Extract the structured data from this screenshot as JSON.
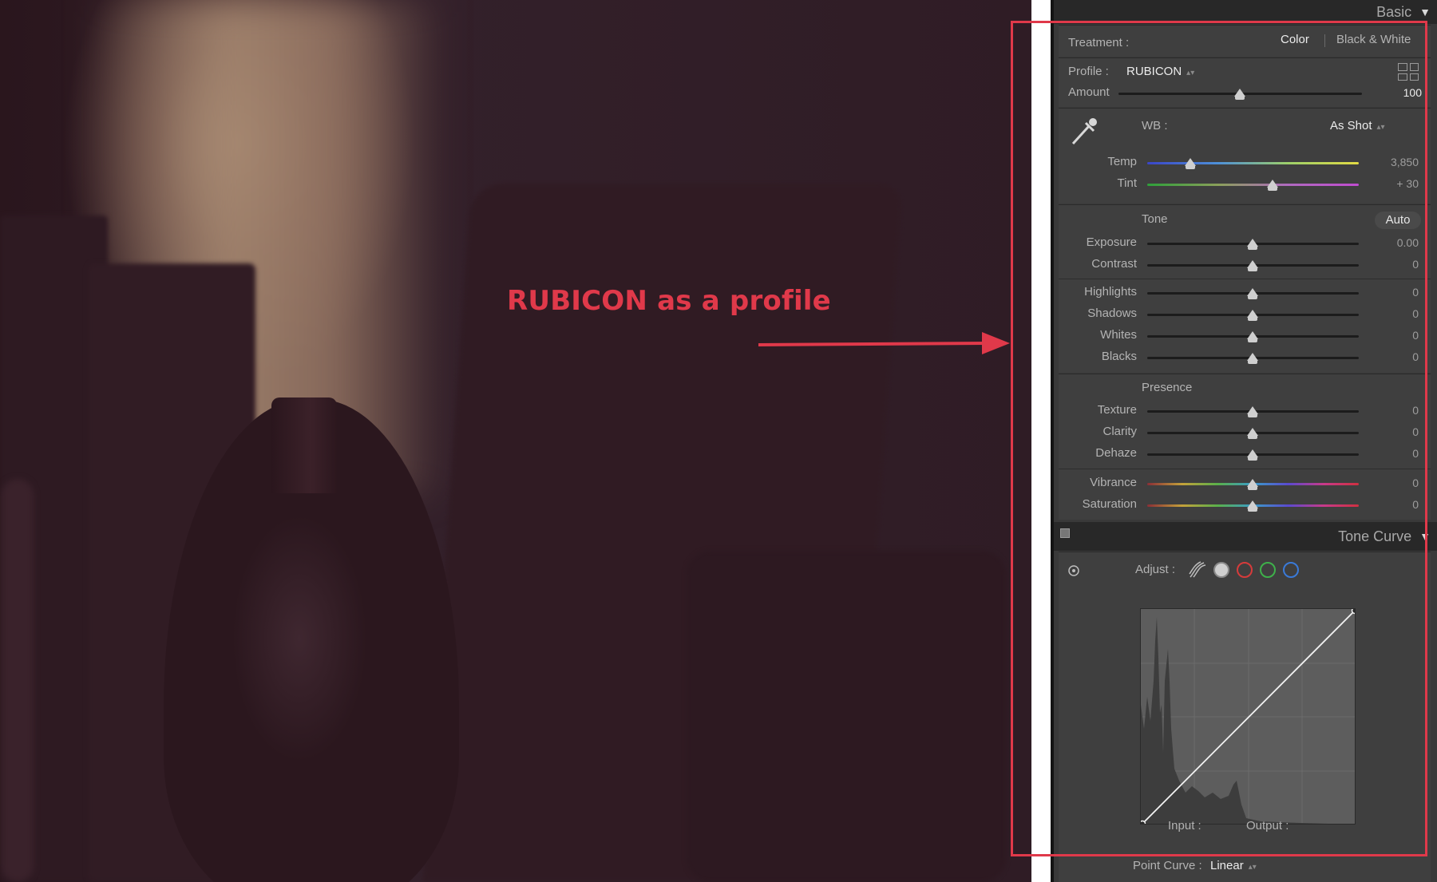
{
  "annotation": {
    "text": "RUBICON as a profile",
    "color": "#e0394a"
  },
  "panel": {
    "basic_header": "Basic",
    "treatment": {
      "label": "Treatment :",
      "options": [
        "Color",
        "Black & White"
      ],
      "selected": "Color"
    },
    "profile": {
      "label": "Profile :",
      "value": "RUBICON"
    },
    "amount": {
      "label": "Amount",
      "value": "100",
      "level_percent": 100
    },
    "wb": {
      "label": "WB :",
      "value": "As Shot"
    },
    "temp": {
      "label": "Temp",
      "value": "3,850"
    },
    "tint": {
      "label": "Tint",
      "value": "+ 30"
    },
    "tone": {
      "title": "Tone",
      "auto_label": "Auto",
      "sliders": [
        {
          "label": "Exposure",
          "value": "0.00"
        },
        {
          "label": "Contrast",
          "value": "0"
        },
        {
          "label": "Highlights",
          "value": "0"
        },
        {
          "label": "Shadows",
          "value": "0"
        },
        {
          "label": "Whites",
          "value": "0"
        },
        {
          "label": "Blacks",
          "value": "0"
        }
      ]
    },
    "presence": {
      "title": "Presence",
      "sliders": [
        {
          "label": "Texture",
          "value": "0"
        },
        {
          "label": "Clarity",
          "value": "0"
        },
        {
          "label": "Dehaze",
          "value": "0"
        },
        {
          "label": "Vibrance",
          "value": "0"
        },
        {
          "label": "Saturation",
          "value": "0"
        }
      ]
    },
    "tone_curve_header": "Tone Curve",
    "tone_curve": {
      "adjust_label": "Adjust :",
      "input_label": "Input :",
      "output_label": "Output :",
      "point_curve_label": "Point Curve :",
      "point_curve_value": "Linear"
    }
  },
  "colors": {
    "accent_red": "#e0394a",
    "panel_bg": "#3f3f3f"
  }
}
